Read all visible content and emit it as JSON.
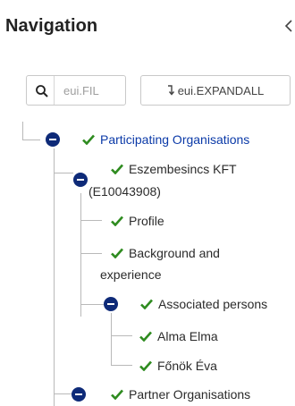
{
  "header": {
    "title": "Navigation",
    "collapse_icon": "chevron-left-icon"
  },
  "toolbar": {
    "search_placeholder": "eui.FIL",
    "expand_all_label": "eui.EXPANDALL",
    "expand_all_icon": "arrow-turn-down-icon"
  },
  "tree": {
    "participating": {
      "label": "Participating Organisations",
      "state": "expanded",
      "selected": true
    },
    "eszembesincs": {
      "label_line1": "Eszembesincs KFT",
      "label_line2": "(E10043908)",
      "state": "expanded"
    },
    "profile": {
      "label": "Profile"
    },
    "background": {
      "label_line1": "Background and",
      "label_line2": "experience"
    },
    "associated": {
      "label": "Associated persons",
      "state": "expanded"
    },
    "alma": {
      "label": "Alma Elma"
    },
    "fonok": {
      "label": "Főnök Éva"
    },
    "partner": {
      "label": "Partner Organisations",
      "state": "expanded"
    }
  },
  "colors": {
    "check": "#2e8b1f",
    "toggle": "#0e2a78",
    "selected_text": "#0b3aa8",
    "line": "#b9b9b9"
  }
}
